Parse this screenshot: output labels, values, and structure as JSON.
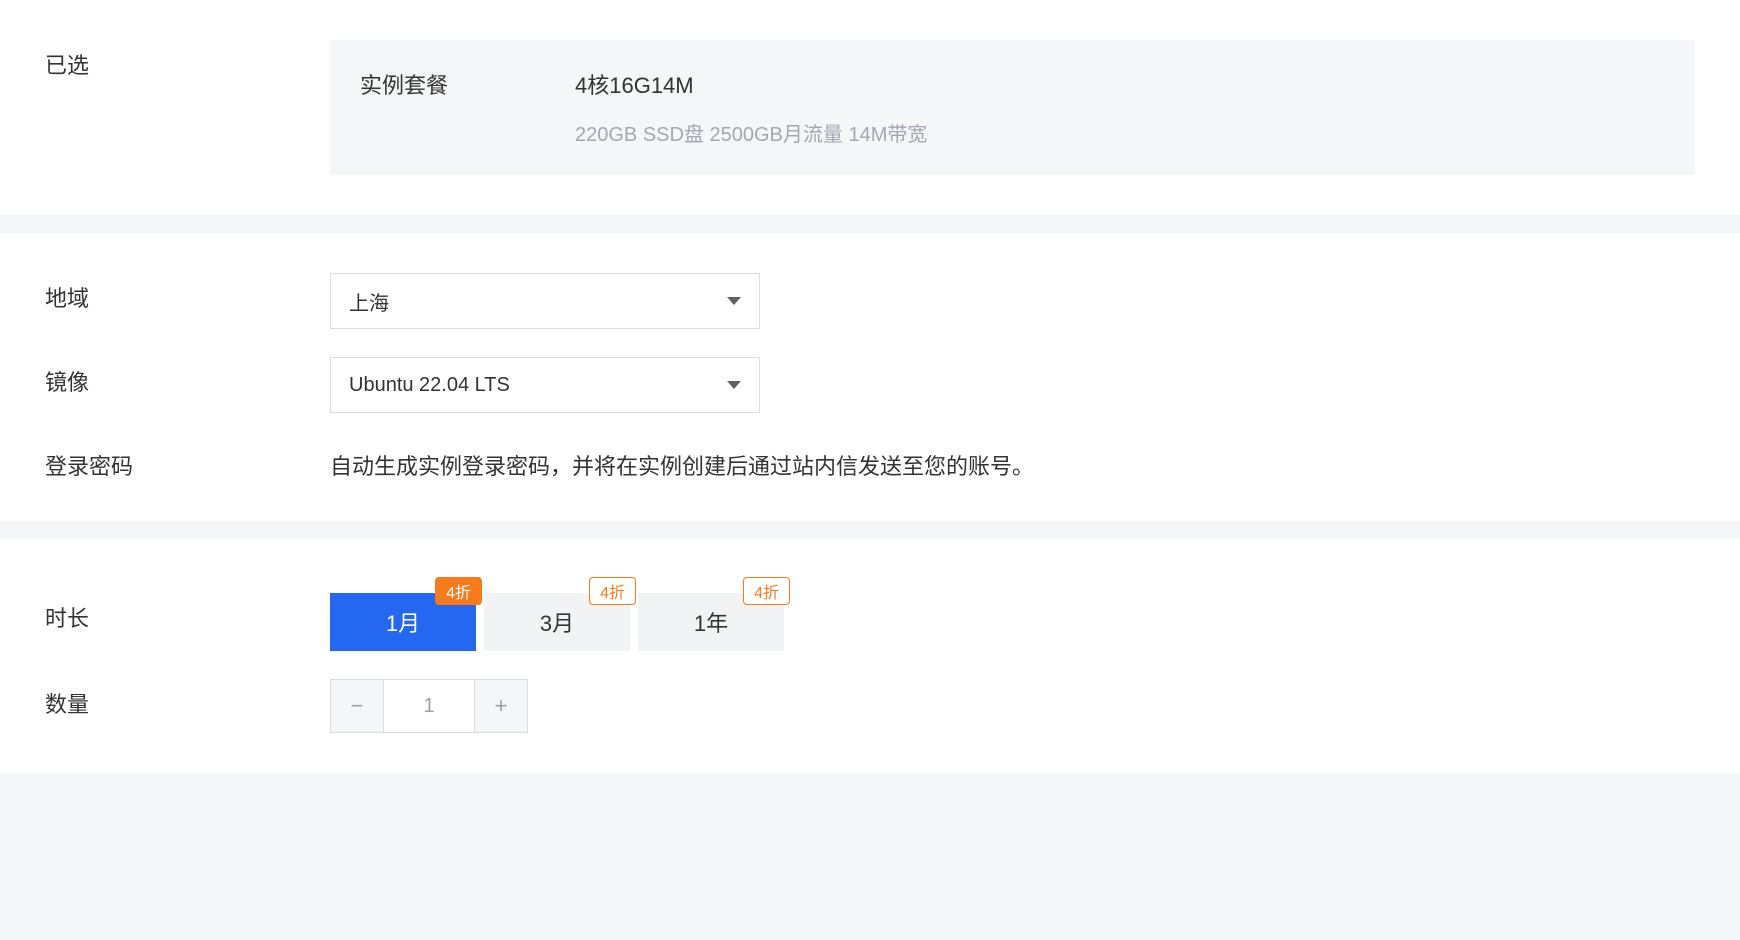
{
  "selected": {
    "section_label": "已选",
    "plan_label": "实例套餐",
    "plan_title": "4核16G14M",
    "plan_desc": "220GB SSD盘 2500GB月流量 14M带宽"
  },
  "region": {
    "label": "地域",
    "value": "上海"
  },
  "image": {
    "label": "镜像",
    "value": "Ubuntu 22.04 LTS"
  },
  "password": {
    "label": "登录密码",
    "info": "自动生成实例登录密码，并将在实例创建后通过站内信发送至您的账号。"
  },
  "duration": {
    "label": "时长",
    "options": [
      {
        "text": "1月",
        "badge": "4折",
        "active": true
      },
      {
        "text": "3月",
        "badge": "4折",
        "active": false
      },
      {
        "text": "1年",
        "badge": "4折",
        "active": false
      }
    ]
  },
  "quantity": {
    "label": "数量",
    "value": "1"
  }
}
